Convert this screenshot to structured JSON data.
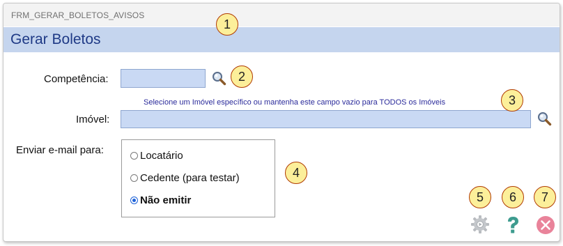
{
  "window": {
    "form_id": "FRM_GERAR_BOLETOS_AVISOS"
  },
  "header": {
    "title": "Gerar Boletos"
  },
  "competencia": {
    "label": "Competência:",
    "value": ""
  },
  "imovel": {
    "label": "Imóvel:",
    "hint": "Selecione um Imóvel específico ou mantenha este campo vazio para TODOS os Imóveis",
    "value": ""
  },
  "email": {
    "label": "Enviar e-mail para:",
    "options": [
      {
        "label": "Locatário",
        "checked": false
      },
      {
        "label": "Cedente (para testar)",
        "checked": false
      },
      {
        "label": "Não emitir",
        "checked": true
      }
    ]
  },
  "markers": [
    "1",
    "2",
    "3",
    "4",
    "5",
    "6",
    "7"
  ],
  "toolbar": {
    "execute_icon": "gear-icon",
    "help_icon": "question-icon",
    "close_icon": "close-icon"
  },
  "colors": {
    "header_bg": "#c5d5ee",
    "title": "#1f3a86",
    "field_bg": "#c9d9f4",
    "marker_fill": "#fcef9a",
    "marker_border": "#b03a00",
    "help": "#3e9c8f",
    "close": "#e9839a"
  }
}
